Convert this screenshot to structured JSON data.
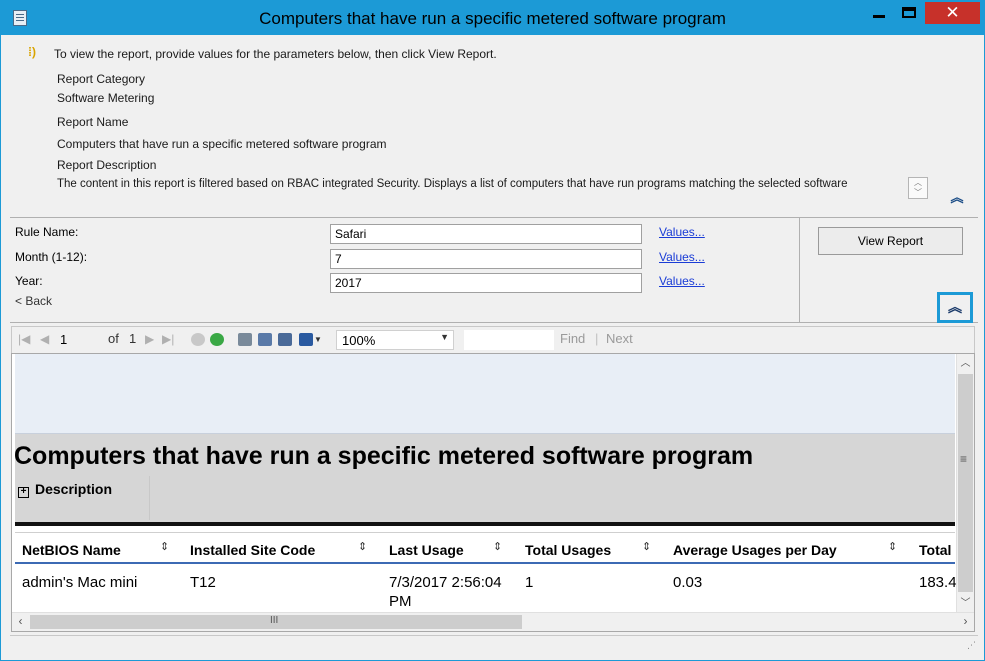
{
  "window": {
    "title": "Computers that have run a specific metered software program",
    "controls": {
      "minimize": "—",
      "maximize": "□",
      "close": "✕"
    }
  },
  "info": {
    "instruction": "To view the report, provide values for the parameters below, then click View Report.",
    "category_label": "Report Category",
    "category_value": "Software Metering",
    "name_label": "Report Name",
    "name_value": "Computers that have run a specific metered software program",
    "description_label": "Report Description",
    "description_value": "The content in this report is filtered based on RBAC integrated Security. Displays a list of computers that have run programs matching the selected software",
    "collapse_glyph": "︽"
  },
  "params": {
    "rule_label": "Rule Name:",
    "rule_value": "Safari",
    "month_label": "Month (1-12):",
    "month_value": "7",
    "year_label": "Year:",
    "year_value": "2017",
    "values_link": "Values...",
    "back_link": "< Back",
    "view_report_button": "View Report",
    "collapse_glyph": "︽"
  },
  "toolbar": {
    "page_current": "1",
    "page_of_label": "of",
    "page_total": "1",
    "zoom": "100%",
    "find_label": "Find",
    "separator": "|",
    "next_label": "Next"
  },
  "report": {
    "title": "Computers that have run a specific metered software program",
    "description_toggle": "Description",
    "columns": [
      "NetBIOS Name",
      "Installed Site Code",
      "Last Usage",
      "Total Usages",
      "Average Usages per Day",
      "Total"
    ],
    "rows": [
      {
        "netbios": "admin's Mac mini",
        "site_code": "T12",
        "last_usage_line1": "7/3/2017 2:56:04",
        "last_usage_line2": "PM",
        "total_usages": "1",
        "avg_per_day": "0.03",
        "total": "183.4"
      }
    ],
    "hscroll_grip": "III",
    "vscroll_grip": "≡"
  },
  "colors": {
    "titlebar": "#1c9ad6",
    "close": "#c7312a",
    "link": "#1a3cd6",
    "header_rule": "#3c6ab4"
  }
}
